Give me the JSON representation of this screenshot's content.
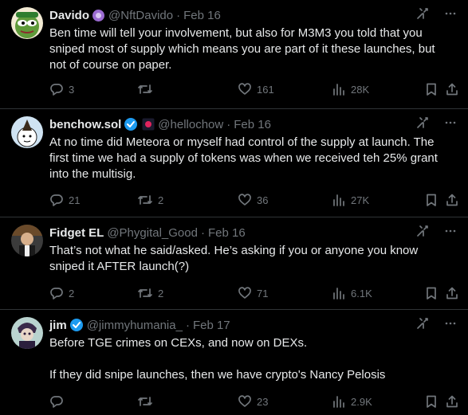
{
  "tweets": [
    {
      "name": "Davido",
      "handle": "@NftDavido",
      "date": "Feb 16",
      "text": "Ben time will tell your involvement, but also for M3M3 you told that you sniped most of supply which means you are part of it these launches, but not of course on paper.",
      "replies": "3",
      "retweets": "",
      "likes": "161",
      "views": "28K"
    },
    {
      "name": "benchow.sol",
      "handle": "@hellochow",
      "date": "Feb 16",
      "text": "At no time did Meteora or myself had control of the supply at launch.  The first time we had a supply of tokens was when we received teh 25% grant into the multisig.",
      "replies": "21",
      "retweets": "2",
      "likes": "36",
      "views": "27K"
    },
    {
      "name": "Fidget EL",
      "handle": "@Phygital_Good",
      "date": "Feb 16",
      "text": "That’s not what he said/asked. He’s asking if you or anyone you know sniped it AFTER launch(?)",
      "replies": "2",
      "retweets": "2",
      "likes": "71",
      "views": "6.1K"
    },
    {
      "name": "jim",
      "handle": "@jimmyhumania_",
      "date": "Feb 17",
      "text": "Before TGE crimes on CEXs, and now on DEXs.\n\nIf they did snipe launches, then we have crypto's Nancy Pelosis",
      "replies": "",
      "retweets": "",
      "likes": "23",
      "views": "2.9K"
    }
  ],
  "separator": "·",
  "colors": {
    "background": "#000000",
    "text": "#e7e9ea",
    "muted": "#71767b",
    "divider": "#2f3336",
    "verified": "#1d9bf0"
  },
  "icons": [
    "grok-icon",
    "more-icon",
    "reply-icon",
    "retweet-icon",
    "like-icon",
    "views-icon",
    "bookmark-icon",
    "share-icon",
    "verified-badge-icon"
  ]
}
